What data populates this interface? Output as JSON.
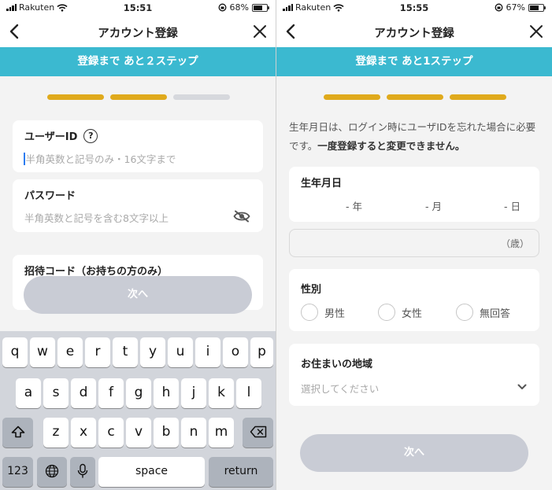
{
  "left": {
    "status": {
      "carrier": "Rakuten",
      "time": "15:51",
      "battery": "68%",
      "battery_level": 0.68
    },
    "title": "アカウント登録",
    "banner": "登録まで あと２ステップ",
    "progress": {
      "total": 3,
      "completed": 2
    },
    "user_id": {
      "label": "ユーザーID",
      "help_icon": "?",
      "placeholder": "半角英数と記号のみ・16文字まで"
    },
    "password": {
      "label": "パスワード",
      "placeholder": "半角英数と記号を含む8文字以上"
    },
    "invite_code": {
      "label": "招待コード（お持ちの方のみ）"
    },
    "next_button": "次へ",
    "keyboard": {
      "row1": [
        "q",
        "w",
        "e",
        "r",
        "t",
        "y",
        "u",
        "i",
        "o",
        "p"
      ],
      "row2": [
        "a",
        "s",
        "d",
        "f",
        "g",
        "h",
        "j",
        "k",
        "l"
      ],
      "row3": [
        "z",
        "x",
        "c",
        "v",
        "b",
        "n",
        "m"
      ],
      "numbers": "123",
      "space": "space",
      "return": "return"
    }
  },
  "right": {
    "status": {
      "carrier": "Rakuten",
      "time": "15:55",
      "battery": "67%",
      "battery_level": 0.67
    },
    "title": "アカウント登録",
    "banner": "登録まで あと1ステップ",
    "progress": {
      "total": 3,
      "completed": 3
    },
    "notice_normal": "生年月日は、ログイン時にユーザIDを忘れた場合に必要です。",
    "notice_bold": "一度登録すると変更できません。",
    "birthday": {
      "label": "生年月日",
      "year": "- 年",
      "month": "- 月",
      "day": "- 日"
    },
    "age_suffix": "（歳）",
    "gender": {
      "label": "性別",
      "options": [
        "男性",
        "女性",
        "無回答"
      ]
    },
    "region": {
      "label": "お住まいの地域",
      "placeholder": "選択してください"
    },
    "next_button": "次へ"
  },
  "colors": {
    "banner": "#3bb9d0",
    "progress_active": "#e0aa1c",
    "progress_inactive": "#d6d8dd",
    "button_disabled": "#c9ccd5"
  }
}
